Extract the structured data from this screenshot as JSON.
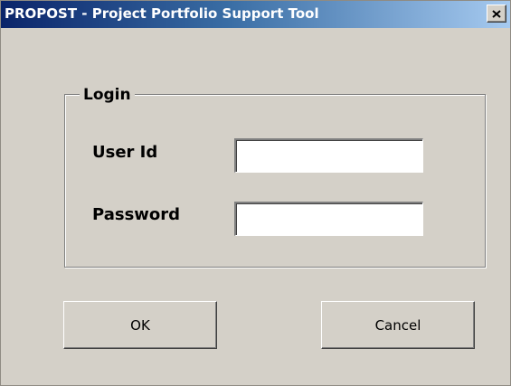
{
  "window": {
    "title": "PROPOST - Project Portfolio Support Tool",
    "close_icon": "close-icon"
  },
  "login": {
    "group_label": "Login",
    "user_id_label": "User Id",
    "user_id_value": "",
    "password_label": "Password",
    "password_value": ""
  },
  "buttons": {
    "ok_label": "OK",
    "cancel_label": "Cancel"
  }
}
